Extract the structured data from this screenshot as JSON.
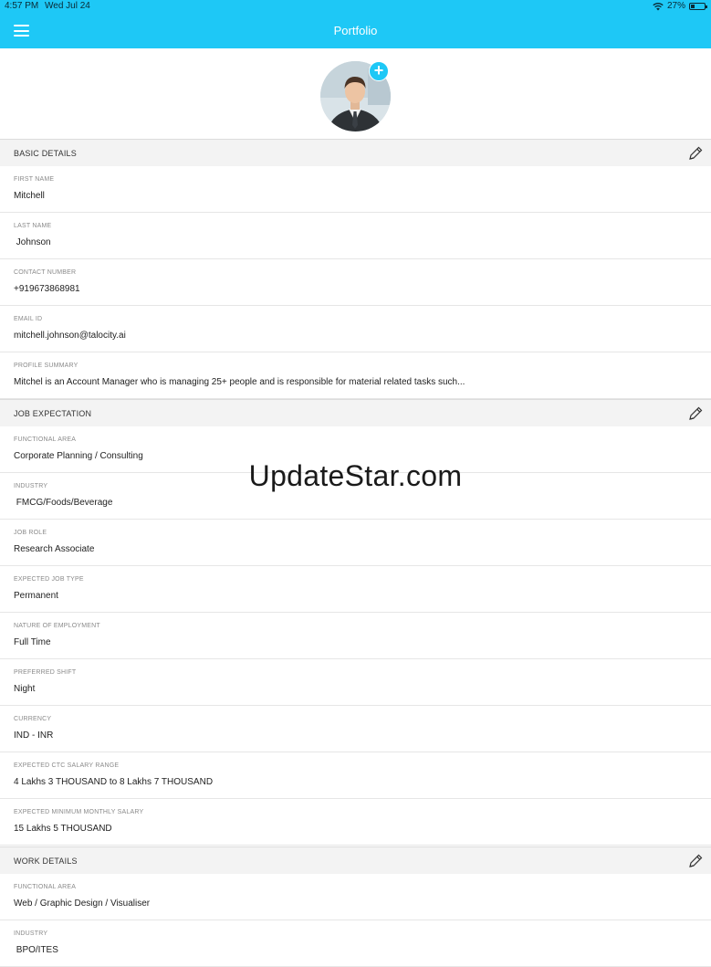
{
  "status_bar": {
    "time": "4:57 PM",
    "date": "Wed Jul 24",
    "battery": "27%",
    "battery_level": 0.27,
    "wifi_icon": "wifi-icon",
    "battery_icon": "battery-icon"
  },
  "nav": {
    "title": "Portfolio",
    "menu_icon": "hamburger-menu-icon",
    "background_color": "#1ec8f6"
  },
  "profile": {
    "add_photo_icon": "plus-icon"
  },
  "basic_details": {
    "title": "BASIC DETAILS",
    "edit_icon": "pencil-icon",
    "fields": [
      {
        "label": "FIRST NAME",
        "value": "Mitchell"
      },
      {
        "label": "LAST NAME",
        "value": " Johnson"
      },
      {
        "label": "CONTACT NUMBER",
        "value": "+919673868981"
      },
      {
        "label": "EMAIL ID",
        "value": "mitchell.johnson@talocity.ai"
      },
      {
        "label": "PROFILE SUMMARY",
        "value": "Mitchel is an Account Manager who is managing 25+ people and is responsible for material related tasks such..."
      }
    ]
  },
  "job_expectation": {
    "title": "JOB EXPECTATION",
    "edit_icon": "pencil-icon",
    "fields": [
      {
        "label": "FUNCTIONAL AREA",
        "value": "Corporate Planning / Consulting"
      },
      {
        "label": "INDUSTRY",
        "value": " FMCG/Foods/Beverage"
      },
      {
        "label": "JOB ROLE",
        "value": "Research Associate"
      },
      {
        "label": "EXPECTED JOB TYPE",
        "value": "Permanent"
      },
      {
        "label": "NATURE OF EMPLOYMENT",
        "value": "Full Time"
      },
      {
        "label": "PREFERRED SHIFT",
        "value": "Night"
      },
      {
        "label": "CURRENCY",
        "value": "IND - INR"
      },
      {
        "label": "EXPECTED CTC SALARY RANGE",
        "value": "4 Lakhs 3 THOUSAND to 8 Lakhs 7 THOUSAND"
      },
      {
        "label": "EXPECTED MINIMUM MONTHLY SALARY",
        "value": "15 Lakhs 5 THOUSAND"
      }
    ]
  },
  "work_details": {
    "title": "WORK DETAILS",
    "edit_icon": "pencil-icon",
    "fields": [
      {
        "label": "FUNCTIONAL AREA",
        "value": "Web / Graphic Design / Visualiser"
      },
      {
        "label": "INDUSTRY",
        "value": " BPO/ITES"
      }
    ]
  },
  "watermark": "UpdateStar.com"
}
